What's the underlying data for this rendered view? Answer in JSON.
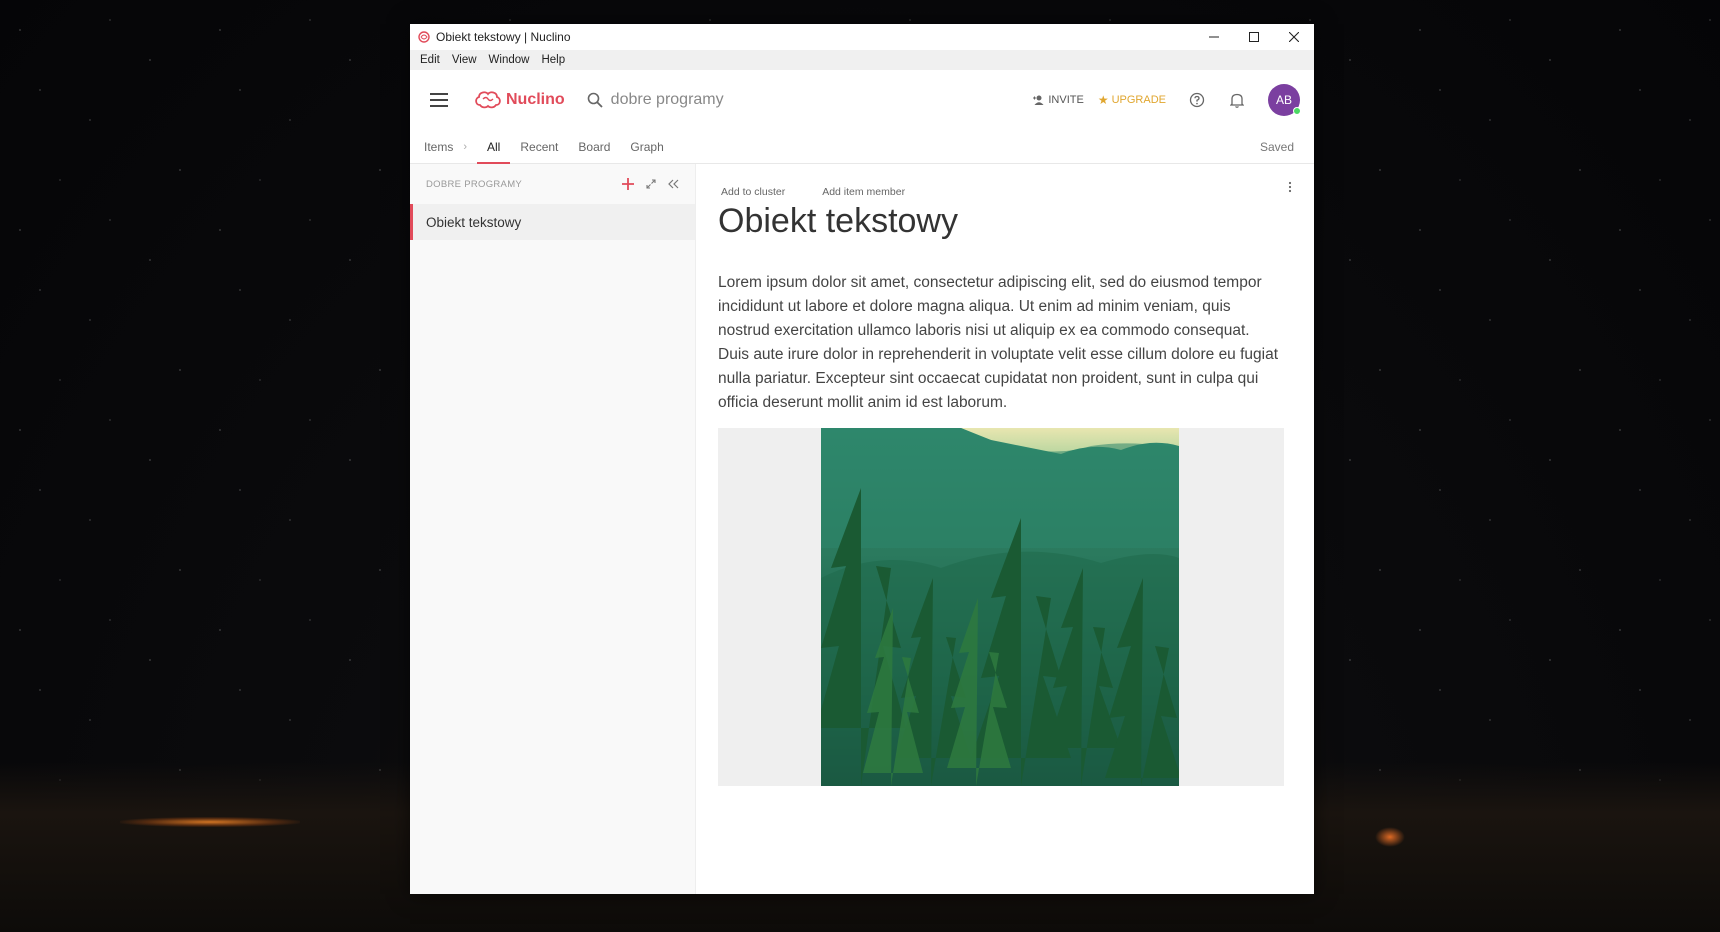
{
  "window": {
    "title": "Obiekt tekstowy | Nuclino",
    "controls": {
      "minimize": "—",
      "maximize": "☐",
      "close": "✕"
    }
  },
  "menubar": [
    "Edit",
    "View",
    "Window",
    "Help"
  ],
  "topbar": {
    "brand": "Nuclino",
    "search_value": "dobre programy",
    "invite_label": "INVITE",
    "upgrade_label": "UPGRADE",
    "avatar_initials": "AB",
    "icons": [
      "menu-icon",
      "search-icon",
      "add-person-icon",
      "star-icon",
      "help-icon",
      "bell-icon"
    ]
  },
  "tabs": {
    "items_label": "Items",
    "list": [
      "All",
      "Recent",
      "Board",
      "Graph"
    ],
    "active": "All",
    "status": "Saved"
  },
  "sidebar": {
    "workspace_label": "DOBRE PROGRAMY",
    "items": [
      "Obiekt tekstowy"
    ]
  },
  "document": {
    "add_cluster": "Add to cluster",
    "add_member": "Add item member",
    "title": "Obiekt tekstowy",
    "body": "Lorem ipsum dolor sit amet, consectetur adipiscing elit, sed do eiusmod  tempor incididunt ut labore et dolore magna aliqua. Ut enim ad minim  veniam, quis nostrud exercitation ullamco laboris nisi ut aliquip ex ea  commodo consequat. Duis aute irure dolor in reprehenderit in voluptate  velit esse cillum dolore eu fugiat nulla pariatur. Excepteur sint  occaecat cupidatat non proident, sunt in culpa qui officia deserunt  mollit anim id est laborum."
  },
  "colors": {
    "accent": "#e14b5a",
    "upgrade": "#e0a62f",
    "avatar": "#7b3fa0"
  }
}
